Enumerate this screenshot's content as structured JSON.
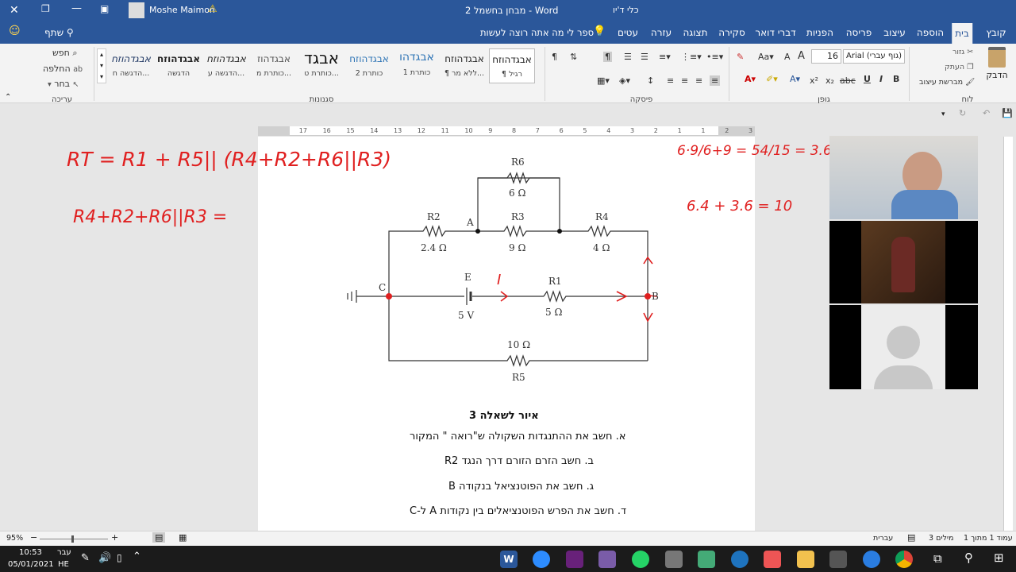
{
  "titlebar": {
    "doc_title": "מבחן בחשמל 2  -  Word",
    "user": "Moshe Maimon",
    "right_label": "כלי ד'יו",
    "warn": "warning-icon"
  },
  "tabs": [
    "קובץ",
    "בית",
    "הוספה",
    "עיצוב",
    "פריסה",
    "הפניות",
    "דברי דואר",
    "סקירה",
    "תצוגה",
    "עזרה",
    "עטים"
  ],
  "tell_me": "ספר לי מה אתה רוצה לעשות",
  "share": "שתף",
  "ribbon": {
    "clipboard": {
      "group": "לוח",
      "paste": "הדבק",
      "cut": "גזור",
      "copy": "העתק",
      "format_painter": "מברשת עיצוב"
    },
    "font": {
      "group": "גופן",
      "font_name": "Arial (גוף עברי)",
      "font_size": "16"
    },
    "paragraph": {
      "group": "פיסקה"
    },
    "styles": {
      "group": "סגנונות",
      "items": [
        {
          "preview": "אבגדהוזח",
          "name": "¶ רגיל"
        },
        {
          "preview": "אבגדהוזח",
          "name": "¶ ללא מר..."
        },
        {
          "preview": "אבגדהו",
          "name": "כותרת 1"
        },
        {
          "preview": "אבגדהוזח",
          "name": "כותרת 2"
        },
        {
          "preview": "אבגד",
          "name": "כותרת ט..."
        },
        {
          "preview": "אבגדהוז",
          "name": "כותרת מ..."
        },
        {
          "preview": "אבגדהוזח",
          "name": "הדגשה ע..."
        },
        {
          "preview": "אבגדהוזח",
          "name": "הדגשה"
        },
        {
          "preview": "אבגדהוזח",
          "name": "הדגשה ח..."
        }
      ]
    },
    "editing": {
      "group": "עריכה",
      "find": "חפש",
      "replace": "החלפה",
      "select": "בחר"
    }
  },
  "ruler": {
    "numbers": [
      "3",
      "2",
      "1",
      "1",
      "2",
      "3",
      "4",
      "5",
      "6",
      "7",
      "8",
      "9",
      "10",
      "11",
      "12",
      "13",
      "14",
      "15",
      "16",
      "17"
    ]
  },
  "circuit": {
    "r6": "R6",
    "r6_val": "6 Ω",
    "r2": "R2",
    "r2_val": "2.4 Ω",
    "r3": "R3",
    "r3_val": "9 Ω",
    "r4": "R4",
    "r4_val": "4 Ω",
    "r1": "R1",
    "r1_val": "5 Ω",
    "r5": "R5",
    "r5_val": "10 Ω",
    "e": "E",
    "e_val": "5 V",
    "a": "A",
    "b": "B",
    "c": "C"
  },
  "document": {
    "caption": "איור לשאלה 3",
    "q1": "א. חשב את ההתנגדות השקולה ש\"רואה \" המקור",
    "q2": "ב. חשב הזרם הזורם דרך הנגד R2",
    "q3": "ג. חשב את הפוטנציאל בנקודה B",
    "q4": "ד. חשב את הפרש הפוטנציאלים בין נקודות A ל-C"
  },
  "ink": {
    "l1": "RT = R1 + R5|| (R4+R2+R6||R3)",
    "l2": "R4+R2+R6||R3 =",
    "r1": "6·9/6+9 = 54/15 = 3.6",
    "r2": "6.4 + 3.6 = 10",
    "current": "I"
  },
  "statusbar": {
    "page": "עמוד 1 מתוך 1",
    "words": "3 מילים",
    "lang": "עברית",
    "zoom": "95%"
  },
  "taskbar": {
    "time": "10:53",
    "date": "05/01/2021",
    "lang1": "עבר",
    "lang2": "HE"
  }
}
